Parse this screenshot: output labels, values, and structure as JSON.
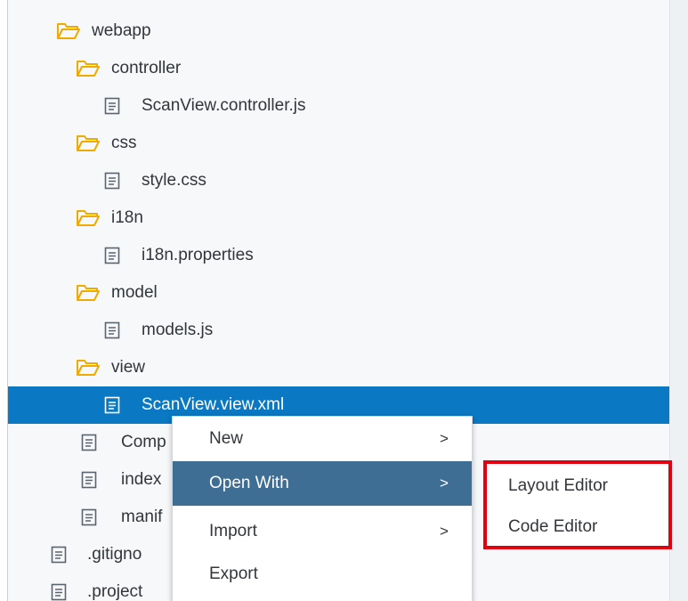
{
  "tree": {
    "items": [
      {
        "label": "webapp",
        "type": "folder"
      },
      {
        "label": "controller",
        "type": "folder"
      },
      {
        "label": "ScanView.controller.js",
        "type": "file"
      },
      {
        "label": "css",
        "type": "folder"
      },
      {
        "label": "style.css",
        "type": "file"
      },
      {
        "label": "i18n",
        "type": "folder"
      },
      {
        "label": "i18n.properties",
        "type": "file"
      },
      {
        "label": "model",
        "type": "folder"
      },
      {
        "label": "models.js",
        "type": "file"
      },
      {
        "label": "view",
        "type": "folder"
      },
      {
        "label": "ScanView.view.xml",
        "type": "file",
        "selected": true
      },
      {
        "label": "Comp",
        "type": "file"
      },
      {
        "label": "index",
        "type": "file"
      },
      {
        "label": "manif",
        "type": "file"
      },
      {
        "label": ".gitigno",
        "type": "file"
      },
      {
        "label": ".project",
        "type": "file"
      }
    ]
  },
  "context_menu": {
    "items": [
      {
        "label": "New",
        "has_submenu": true,
        "chevron": ">"
      },
      {
        "label": "Open With",
        "has_submenu": true,
        "chevron": ">",
        "active": true
      },
      {
        "label": "Import",
        "has_submenu": true,
        "chevron": ">"
      },
      {
        "label": "Export",
        "has_submenu": false
      }
    ]
  },
  "submenu": {
    "items": [
      {
        "label": "Layout Editor"
      },
      {
        "label": "Code Editor"
      }
    ]
  },
  "colors": {
    "folder": "#f0ab00",
    "selection": "#0a78c3",
    "menu_active": "#3f6e94",
    "highlight_border": "#e3000f"
  }
}
